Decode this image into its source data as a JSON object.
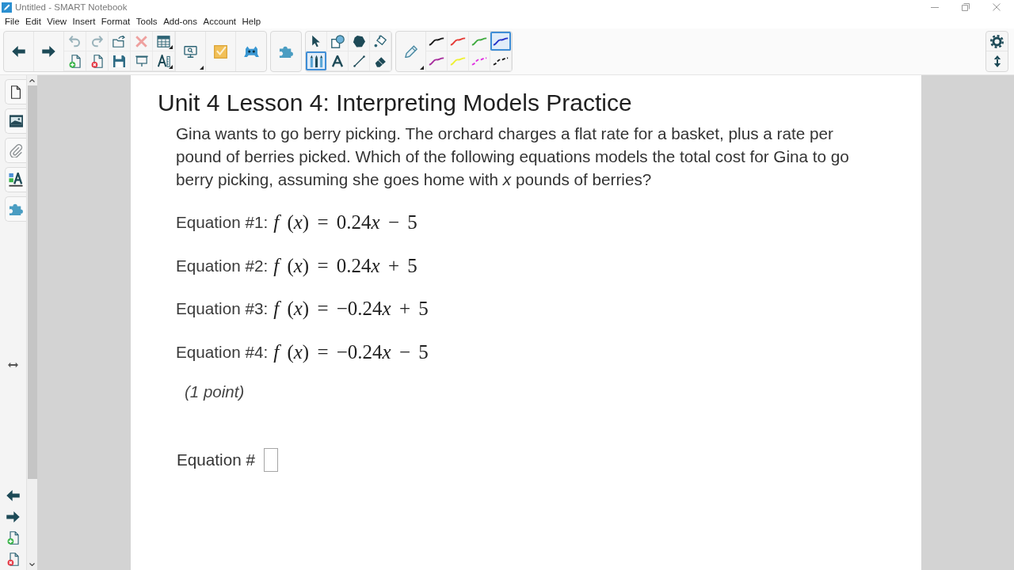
{
  "window": {
    "title": "Untitled - SMART Notebook"
  },
  "menu": [
    "File",
    "Edit",
    "View",
    "Insert",
    "Format",
    "Tools",
    "Add-ons",
    "Account",
    "Help"
  ],
  "toolbar": {
    "edit_buttons": [
      {
        "kind": "undo",
        "disabled": true
      },
      {
        "kind": "redo",
        "disabled": true
      },
      {
        "kind": "open",
        "disabled": false
      },
      {
        "kind": "delete",
        "disabled": true
      },
      {
        "kind": "table",
        "disabled": false
      },
      {
        "kind": "newpage",
        "disabled": false
      },
      {
        "kind": "deletepage",
        "disabled": false
      },
      {
        "kind": "save",
        "disabled": false
      },
      {
        "kind": "shade",
        "disabled": false
      },
      {
        "kind": "properties",
        "disabled": false
      }
    ],
    "tools": [
      {
        "kind": "select",
        "selected": false
      },
      {
        "kind": "shapes",
        "selected": false
      },
      {
        "kind": "polygon",
        "selected": false
      },
      {
        "kind": "fill",
        "selected": false
      },
      {
        "kind": "pens",
        "selected": true
      },
      {
        "kind": "text",
        "selected": false
      },
      {
        "kind": "line",
        "selected": false
      },
      {
        "kind": "eraser",
        "selected": false
      }
    ],
    "pens": [
      {
        "kind": "solid",
        "color": "#1a1a1a",
        "selected": false
      },
      {
        "kind": "solid",
        "color": "#e53935",
        "selected": false
      },
      {
        "kind": "solid",
        "color": "#3faa3f",
        "selected": false
      },
      {
        "kind": "solid",
        "color": "#2733c8",
        "selected": true
      },
      {
        "kind": "solid",
        "color": "#a8309e",
        "selected": false
      },
      {
        "kind": "solid",
        "color": "#eef032",
        "selected": false
      },
      {
        "kind": "dashed",
        "color": "#e02de0",
        "selected": false
      },
      {
        "kind": "dashed",
        "color": "#1a1a1a",
        "selected": false
      }
    ]
  },
  "page": {
    "title": "Unit 4 Lesson 4: Interpreting Models Practice",
    "question": "Gina wants to go berry picking. The orchard charges a flat rate for a basket, plus a rate per pound of berries picked. Which of the following equations models the total cost for Gina to go berry picking, assuming she goes home with *x* pounds of berries?",
    "equations": [
      {
        "label": "Equation #1:",
        "formula": "f (x) = 0.24x − 5"
      },
      {
        "label": "Equation #2:",
        "formula": "f (x) = 0.24x + 5"
      },
      {
        "label": "Equation #3:",
        "formula": "f (x) = −0.24x + 5"
      },
      {
        "label": "Equation #4:",
        "formula": "f (x) = −0.24x − 5"
      }
    ],
    "points": "(1 point)",
    "answer": {
      "label": "Equation #"
    }
  }
}
